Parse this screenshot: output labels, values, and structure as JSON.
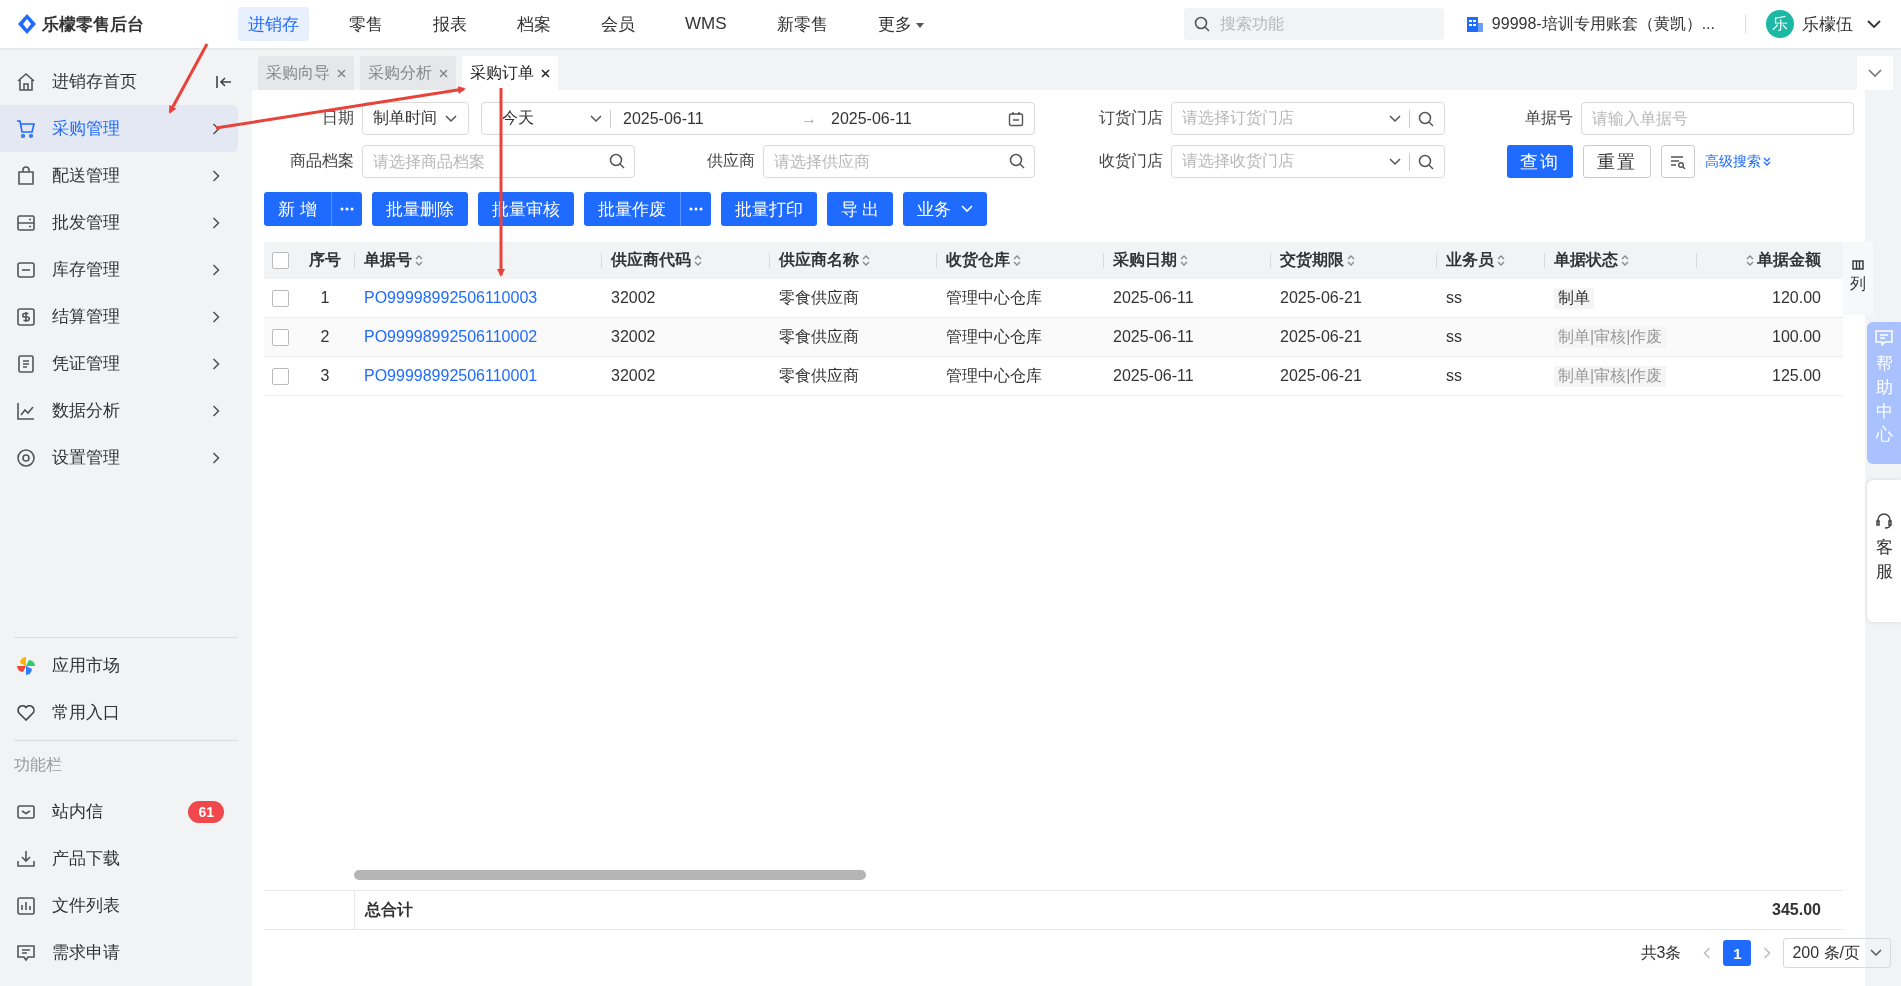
{
  "top_bar": {
    "logo": "乐檬零售后台",
    "nav": [
      {
        "label": "进销存",
        "selected": true,
        "dropdown": false
      },
      {
        "label": "零售",
        "selected": false,
        "dropdown": false
      },
      {
        "label": "报表",
        "selected": false,
        "dropdown": false
      },
      {
        "label": "档案",
        "selected": false,
        "dropdown": false
      },
      {
        "label": "会员",
        "selected": false,
        "dropdown": false
      },
      {
        "label": "WMS",
        "selected": false,
        "dropdown": false
      },
      {
        "label": "新零售",
        "selected": false,
        "dropdown": false
      },
      {
        "label": "更多",
        "selected": false,
        "dropdown": true
      }
    ],
    "search": {
      "placeholder": "搜索功能"
    },
    "account": "99998-培训专用账套（黄凯）...",
    "avatar": "乐",
    "user": "乐檬伍"
  },
  "sidebar": {
    "items": [
      {
        "label": "进销存首页",
        "selected": false,
        "expandable": false
      },
      {
        "label": "采购管理",
        "selected": true,
        "expandable": true
      },
      {
        "label": "配送管理",
        "selected": false,
        "expandable": true
      },
      {
        "label": "批发管理",
        "selected": false,
        "expandable": true
      },
      {
        "label": "库存管理",
        "selected": false,
        "expandable": true
      },
      {
        "label": "结算管理",
        "selected": false,
        "expandable": true
      },
      {
        "label": "凭证管理",
        "selected": false,
        "expandable": true
      },
      {
        "label": "数据分析",
        "selected": false,
        "expandable": true
      },
      {
        "label": "设置管理",
        "selected": false,
        "expandable": true
      }
    ],
    "shortcuts": [
      {
        "label": "应用市场"
      },
      {
        "label": "常用入口"
      }
    ],
    "section_title": "功能栏",
    "tools": [
      {
        "label": "站内信",
        "badge": "61"
      },
      {
        "label": "产品下载"
      },
      {
        "label": "文件列表"
      },
      {
        "label": "需求申请"
      }
    ]
  },
  "tabs": [
    {
      "label": "采购向导",
      "selected": false
    },
    {
      "label": "采购分析",
      "selected": false
    },
    {
      "label": "采购订单",
      "selected": true
    }
  ],
  "filters": {
    "date": {
      "label": "日期",
      "type": "制单时间",
      "preset": "今天",
      "start": "2025-06-11",
      "separator": "→",
      "end": "2025-06-11"
    },
    "order_store": {
      "label": "订货门店",
      "placeholder": "请选择订货门店"
    },
    "doc_no": {
      "label": "单据号",
      "placeholder": "请输入单据号"
    },
    "product": {
      "label": "商品档案",
      "placeholder": "请选择商品档案"
    },
    "supplier": {
      "label": "供应商",
      "placeholder": "请选择供应商"
    },
    "receive_store": {
      "label": "收货门店",
      "placeholder": "请选择收货门店"
    },
    "query": "查询",
    "reset": "重置",
    "advanced": "高级搜索"
  },
  "actions": [
    {
      "label": "新 增",
      "kind": "split"
    },
    {
      "label": "批量删除",
      "kind": "plain"
    },
    {
      "label": "批量审核",
      "kind": "plain"
    },
    {
      "label": "批量作废",
      "kind": "split"
    },
    {
      "label": "批量打印",
      "kind": "plain"
    },
    {
      "label": "导 出",
      "kind": "plain"
    },
    {
      "label": "业务",
      "kind": "dropdown"
    }
  ],
  "table": {
    "all_checked": false,
    "columns": [
      {
        "label": "序号",
        "sortable": false
      },
      {
        "label": "单据号",
        "sortable": true
      },
      {
        "label": "供应商代码",
        "sortable": true
      },
      {
        "label": "供应商名称",
        "sortable": true
      },
      {
        "label": "收货仓库",
        "sortable": true
      },
      {
        "label": "采购日期",
        "sortable": true
      },
      {
        "label": "交货期限",
        "sortable": true
      },
      {
        "label": "业务员",
        "sortable": true
      },
      {
        "label": "单据状态",
        "sortable": true
      },
      {
        "label": "单据金额",
        "sortable": true
      }
    ],
    "rows": [
      {
        "checked": false,
        "cells": [
          "1",
          "PO99998992506110003",
          "32002",
          "零食供应商",
          "管理中心仓库",
          "2025-06-11",
          "2025-06-21",
          "ss",
          "制单",
          "120.00"
        ],
        "status_greyed": false
      },
      {
        "checked": false,
        "cells": [
          "2",
          "PO99998992506110002",
          "32002",
          "零食供应商",
          "管理中心仓库",
          "2025-06-11",
          "2025-06-21",
          "ss",
          "制单|审核|作废",
          "100.00"
        ],
        "status_greyed": true
      },
      {
        "checked": false,
        "cells": [
          "3",
          "PO99998992506110001",
          "32002",
          "零食供应商",
          "管理中心仓库",
          "2025-06-11",
          "2025-06-21",
          "ss",
          "制单|审核|作废",
          "125.00"
        ],
        "status_greyed": true
      }
    ],
    "column_setting": "列",
    "total_label": "总合计",
    "total_amount": "345.00"
  },
  "pagination": {
    "total": "共3条",
    "pages": [
      {
        "label": "1",
        "selected": true
      }
    ],
    "page_size": "200 条/页"
  },
  "float_panel": {
    "help": "帮助中心",
    "service": "客服"
  }
}
